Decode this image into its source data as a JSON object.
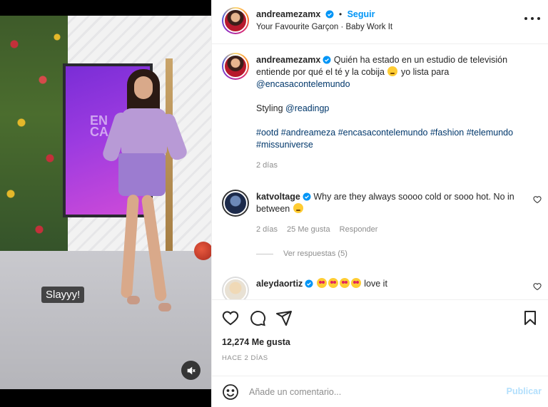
{
  "media": {
    "caption_chip": "Slayyy!",
    "mute_icon": "speaker-muted-icon"
  },
  "header": {
    "username": "andreamezamx",
    "separator": "•",
    "follow_label": "Seguir",
    "audio": "Your Favourite Garçon · Baby Work It",
    "more_icon": "more-options-icon"
  },
  "post": {
    "username": "andreamezamx",
    "text_1": "Quién ha estado en un estudio de televisión entiende por qué el té y la cobija",
    "text_2": "yo lista para",
    "mention": "@encasacontelemundo",
    "styling_label": "Styling",
    "styling_mention": "@readingp",
    "hashtags": [
      "#ootd",
      "#andreameza",
      "#encasacontelemundo",
      "#fashion",
      "#telemundo",
      "#missuniverse"
    ],
    "time": "2 días"
  },
  "comments": [
    {
      "username": "katvoltage",
      "text": "Why are they always soooo cold or sooo hot. No in between",
      "time": "2 días",
      "likes": "25 Me gusta",
      "reply_label": "Responder",
      "view_replies": "Ver respuestas (5)"
    },
    {
      "username": "aleydaortiz",
      "text": "love it"
    }
  ],
  "actions": {
    "like_icon": "heart-icon",
    "comment_icon": "comment-icon",
    "share_icon": "share-icon",
    "save_icon": "bookmark-icon"
  },
  "likes_count": "12,274 Me gusta",
  "posted_ago": "HACE 2 DÍAS",
  "comment_box": {
    "placeholder": "Añade un comentario...",
    "publish_label": "Publicar"
  },
  "colors": {
    "link_blue": "#0095f6",
    "publish_disabled": "#b2dffc",
    "hashtag": "#00376b",
    "muted_text": "#8e8e8e"
  }
}
